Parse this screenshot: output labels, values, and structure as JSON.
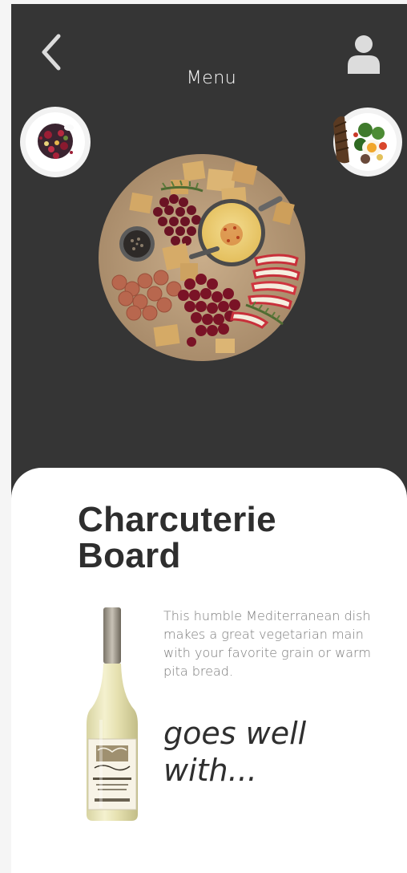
{
  "header": {
    "title": "Menu",
    "back_icon": "chevron-left-icon",
    "profile_icon": "user-icon"
  },
  "carousel": {
    "left_plate": "dessert-plate",
    "center_plate": "charcuterie-board-plate",
    "right_plate": "breakfast-plate"
  },
  "dish": {
    "title_line1": "Charcuterie",
    "title_line2": "Board",
    "description": "This humble Mediterranean dish makes a great vegetarian main with your favorite grain or warm pita bread.",
    "pairing_line1": "goes well",
    "pairing_line2": "with..."
  },
  "colors": {
    "top_background": "#353535",
    "card_background": "#ffffff",
    "title_text": "#2e2e2e",
    "description_text": "#7a7a7a"
  }
}
